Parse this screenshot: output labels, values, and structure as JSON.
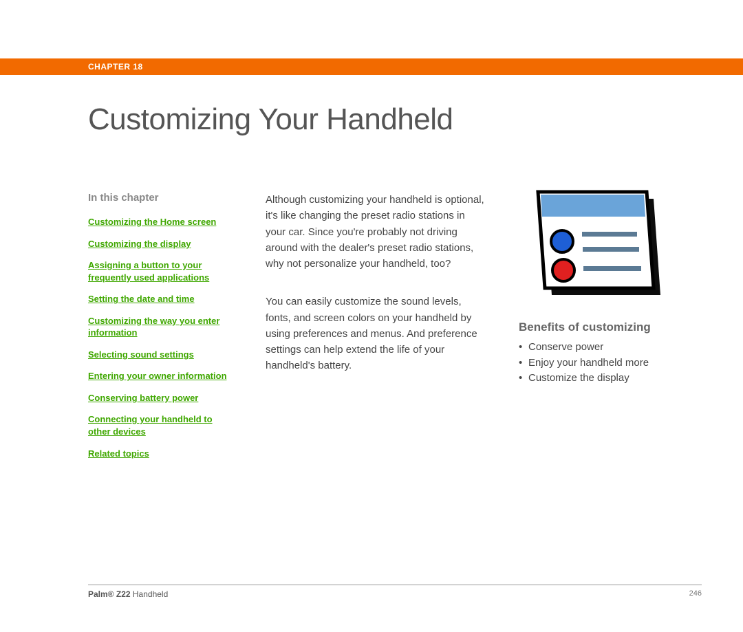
{
  "chapter_label": "CHAPTER 18",
  "title": "Customizing Your Handheld",
  "sidebar": {
    "heading": "In this chapter",
    "links": [
      "Customizing the Home screen",
      "Customizing the display",
      "Assigning a button to your frequently used applications",
      "Setting the date and time",
      "Customizing the way you enter information",
      "Selecting sound settings",
      "Entering your owner information",
      "Conserving battery power",
      "Connecting your handheld to other devices",
      "Related topics"
    ]
  },
  "body": {
    "p1": "Although customizing your handheld is optional, it's like changing the preset radio stations in your car. Since you're probably not driving around with the dealer's preset radio stations, why not personalize your handheld, too?",
    "p2": "You can easily customize the sound levels, fonts, and screen colors on your handheld by using preferences and menus. And preference settings can help extend the life of your handheld's battery."
  },
  "benefits": {
    "heading": "Benefits of customizing",
    "items": [
      "Conserve power",
      "Enjoy your handheld more",
      "Customize the display"
    ]
  },
  "footer": {
    "product_bold": "Palm® Z22",
    "product_rest": " Handheld",
    "page_number": "246"
  }
}
